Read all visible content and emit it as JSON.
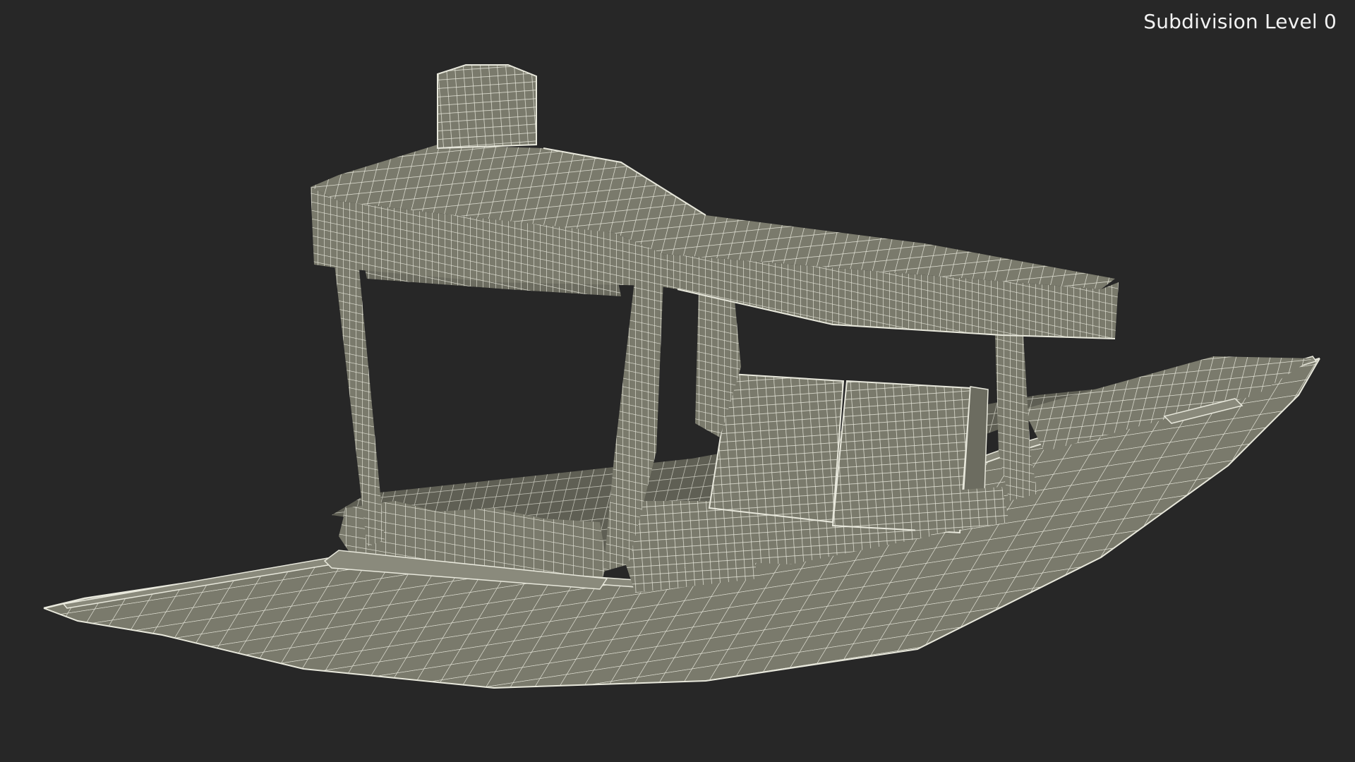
{
  "viewport": {
    "overlay_label": "Subdivision Level 0",
    "background_color": "#272727",
    "model_fill_color": "#7a7a6c",
    "model_shadow_color": "#5f5f54",
    "wire_color": "#e8e8dc"
  },
  "model": {
    "render_mode": "wireframe-on-shaded",
    "subject_icon": "shikara-boat-icon"
  }
}
